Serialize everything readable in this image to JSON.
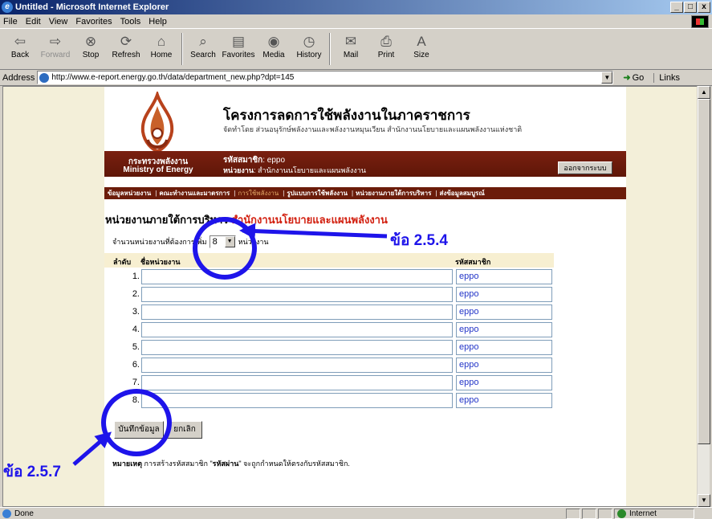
{
  "window": {
    "title": "Untitled - Microsoft Internet Explorer",
    "buttons": [
      "_",
      "□",
      "x"
    ]
  },
  "menu": [
    "File",
    "Edit",
    "View",
    "Favorites",
    "Tools",
    "Help"
  ],
  "toolbar": {
    "back": "Back",
    "forward": "Forward",
    "stop": "Stop",
    "refresh": "Refresh",
    "home": "Home",
    "search": "Search",
    "favorites": "Favorites",
    "media": "Media",
    "history": "History",
    "mail": "Mail",
    "print": "Print",
    "size": "Size"
  },
  "address": {
    "label": "Address",
    "url": "http://www.e-report.energy.go.th/data/department_new.php?dpt=145",
    "go": "Go",
    "links": "Links"
  },
  "header": {
    "brand_th": "กระทรวงพลังงาน",
    "brand_en": "Ministry of Energy",
    "title": "โครงการลดการใช้พลังงานในภาคราชการ",
    "subtitle": "จัดทำโดย ส่วนอนุรักษ์พลังงานและพลังงานหมุนเวียน สำนักงานนโยบายและแผนพลังงานแห่งชาติ",
    "member_label": "รหัสสมาชิก",
    "member_value": "eppo",
    "unit_label": "หน่วยงาน",
    "unit_value": "สำนักงานนโยบายและแผนพลังงาน",
    "logout": "ออกจากระบบ"
  },
  "nav": [
    "ข้อมูลหน่วยงาน",
    "คณะทำงานและมาตรการ",
    "การใช้พลังงาน",
    "รูปแบบการใช้พลังงาน",
    "หน่วยงานภายใต้การบริหาร",
    "ส่งข้อมูลสมบูรณ์"
  ],
  "main": {
    "heading": "หน่วยงานภายใต้การบริหาร",
    "heading_dept": "สำนักงานนโยบายและแผนพลังงาน",
    "count_label": "จำนวนหน่วยงานที่ต้องการเพิ่ม",
    "count_value": "8",
    "count_unit": "หน่วยงาน",
    "columns": {
      "no": "ลำดับ",
      "name": "ชื่อหน่วยงาน",
      "code": "รหัสสมาชิก"
    },
    "rows": [
      {
        "no": "1.",
        "name": "",
        "code": "eppo"
      },
      {
        "no": "2.",
        "name": "",
        "code": "eppo"
      },
      {
        "no": "3.",
        "name": "",
        "code": "eppo"
      },
      {
        "no": "4.",
        "name": "",
        "code": "eppo"
      },
      {
        "no": "5.",
        "name": "",
        "code": "eppo"
      },
      {
        "no": "6.",
        "name": "",
        "code": "eppo"
      },
      {
        "no": "7.",
        "name": "",
        "code": "eppo"
      },
      {
        "no": "8.",
        "name": "",
        "code": "eppo"
      }
    ],
    "save": "บันทึกข้อมูล",
    "cancel": "ยกเลิก",
    "note_label": "หมายเหตุ",
    "note_text_1": " การสร้างรหัสสมาชิก \"",
    "note_bold": "รหัสผ่าน",
    "note_text_2": "\" จะถูกกำหนดให้ตรงกับรหัสสมาชิก."
  },
  "annotations": {
    "a1": "ข้อ 2.5.4",
    "a2": "ข้อ 2.5.7",
    "color": "#1e14ea"
  },
  "status": {
    "text": "Done",
    "zone": "Internet"
  },
  "colors": {
    "member_bar": "#6b1c0a",
    "heading_dept": "#d22010",
    "page_bg": "#f3efd9"
  }
}
